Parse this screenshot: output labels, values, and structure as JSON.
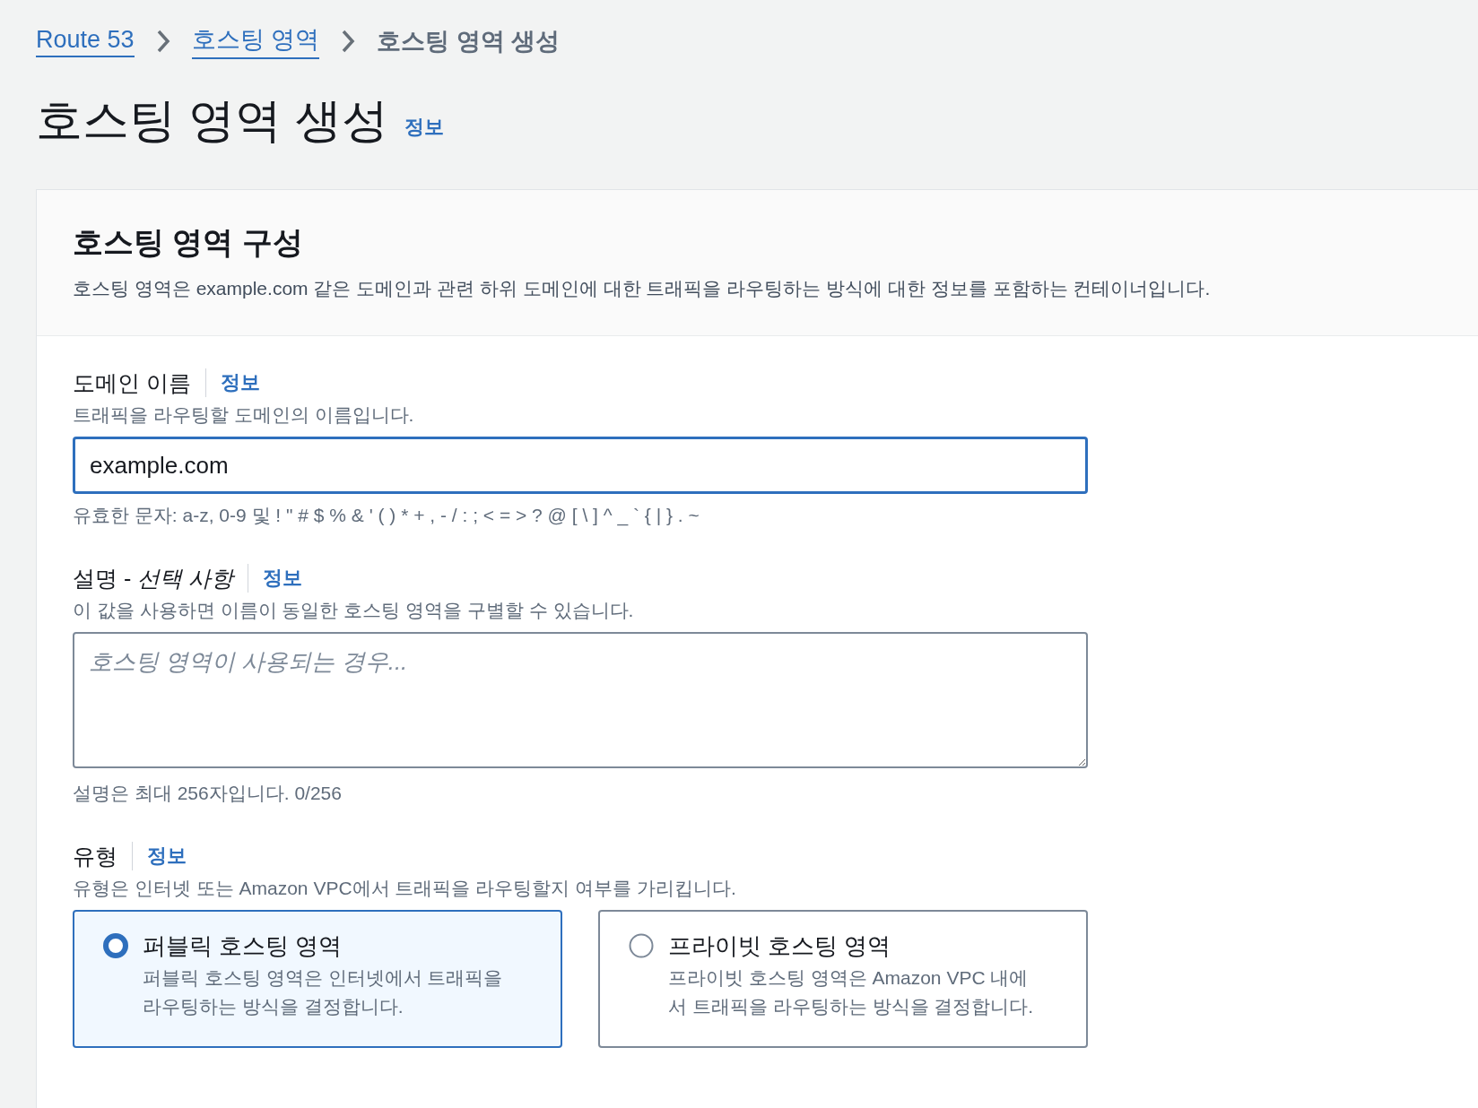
{
  "breadcrumbs": [
    {
      "label": "Route 53",
      "link": true
    },
    {
      "label": "호스팅 영역",
      "link": true
    },
    {
      "label": "호스팅 영역 생성",
      "link": false
    }
  ],
  "page": {
    "title": "호스팅 영역 생성",
    "info": "정보"
  },
  "panel": {
    "title": "호스팅 영역 구성",
    "description": "호스팅 영역은 example.com 같은 도메인과 관련 하위 도메인에 대한 트래픽을 라우팅하는 방식에 대한 정보를 포함하는 컨테이너입니다."
  },
  "fields": [
    {
      "kind": "input",
      "label": "도메인 이름",
      "info": "정보",
      "description": "트래픽을 라우팅할 도메인의 이름입니다.",
      "value": "example.com",
      "focused": true,
      "constraint": "유효한 문자: a-z, 0-9 및 ! \" # $ % & ' ( ) * + , - / : ; < = > ? @ [ \\ ] ^ _ ` { | } . ~"
    },
    {
      "kind": "textarea",
      "label": "설명 - *선택 사항*",
      "info": "정보",
      "description": "이 값을 사용하면 이름이 동일한 호스팅 영역을 구별할 수 있습니다.",
      "placeholder": "호스팅 영역이 사용되는 경우...",
      "focused": false,
      "constraint": "설명은 최대 256자입니다. 0/256"
    },
    {
      "kind": "radio",
      "label": "유형",
      "info": "정보",
      "description": "유형은 인터넷 또는 Amazon VPC에서 트래픽을 라우팅할지 여부를 가리킵니다.",
      "options": [
        {
          "title": "퍼블릭 호스팅 영역",
          "description": "퍼블릭 호스팅 영역은 인터넷에서 트래픽을 라우팅하는 방식을 결정합니다.",
          "selected": true
        },
        {
          "title": "프라이빗 호스팅 영역",
          "description": "프라이빗 호스팅 영역은 Amazon VPC 내에서 트래픽을 라우팅하는 방식을 결정합니다.",
          "selected": false
        }
      ]
    }
  ]
}
